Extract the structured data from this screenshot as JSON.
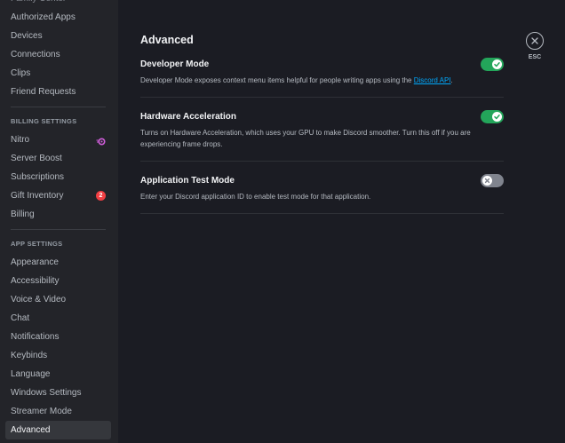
{
  "sidebar": {
    "top_items": [
      {
        "label": "Family Center"
      },
      {
        "label": "Authorized Apps"
      },
      {
        "label": "Devices"
      },
      {
        "label": "Connections"
      },
      {
        "label": "Clips"
      },
      {
        "label": "Friend Requests"
      }
    ],
    "billing_header": "BILLING SETTINGS",
    "billing_items": [
      {
        "label": "Nitro",
        "icon": "nitro-icon"
      },
      {
        "label": "Server Boost"
      },
      {
        "label": "Subscriptions"
      },
      {
        "label": "Gift Inventory",
        "badge": "2"
      },
      {
        "label": "Billing"
      }
    ],
    "app_header": "APP SETTINGS",
    "app_items": [
      {
        "label": "Appearance"
      },
      {
        "label": "Accessibility"
      },
      {
        "label": "Voice & Video"
      },
      {
        "label": "Chat"
      },
      {
        "label": "Notifications"
      },
      {
        "label": "Keybinds"
      },
      {
        "label": "Language"
      },
      {
        "label": "Windows Settings"
      },
      {
        "label": "Streamer Mode"
      },
      {
        "label": "Advanced",
        "active": true
      }
    ]
  },
  "main": {
    "title": "Advanced",
    "settings": [
      {
        "title": "Developer Mode",
        "desc_before": "Developer Mode exposes context menu items helpful for people writing apps using the ",
        "desc_link": "Discord API",
        "desc_after": ".",
        "enabled": true
      },
      {
        "title": "Hardware Acceleration",
        "desc": "Turns on Hardware Acceleration, which uses your GPU to make Discord smoother. Turn this off if you are experiencing frame drops.",
        "enabled": true
      },
      {
        "title": "Application Test Mode",
        "desc": "Enter your Discord application ID to enable test mode for that application.",
        "enabled": false
      }
    ]
  },
  "close": {
    "label": "ESC",
    "icon": "close-icon"
  },
  "colors": {
    "toggle_on": "#23a55a",
    "toggle_off": "#80848e",
    "badge": "#f23f43",
    "nitro": "#d15edb",
    "link": "#00a8fc"
  }
}
